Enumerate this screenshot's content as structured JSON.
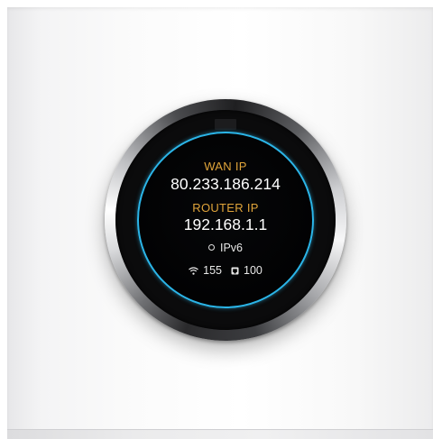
{
  "screen": {
    "wan_label": "WAN IP",
    "wan_ip": "80.233.186.214",
    "router_label": "ROUTER IP",
    "router_ip": "192.168.1.1",
    "ipv6_label": "IPv6",
    "wifi_clients": "155",
    "wired_clients": "100"
  },
  "icons": {
    "ipv6_status": "ring-icon",
    "wifi": "wifi-icon",
    "wired": "ethernet-port-icon"
  },
  "colors": {
    "label": "#e0a43a",
    "value": "#ffffff",
    "screen_ring": "#2bb5e8",
    "screen_background": "#000000"
  }
}
